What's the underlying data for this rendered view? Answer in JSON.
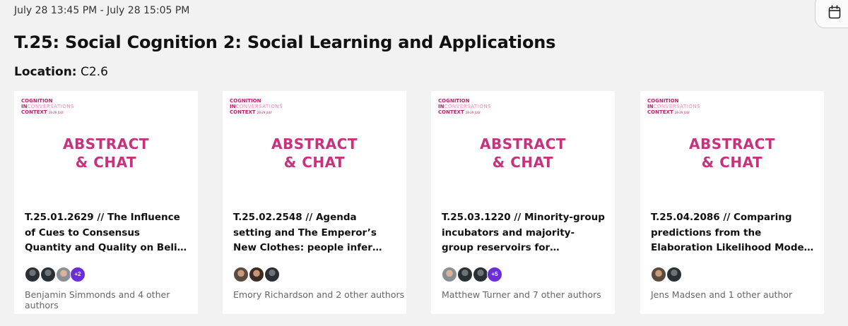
{
  "header": {
    "datetime": "July 28 13:45 PM - July 28 15:05 PM",
    "calendar_icon": "calendar-icon"
  },
  "session": {
    "title": "T.25: Social Cognition 2: Social Learning and Applications",
    "location_label": "Location:",
    "location_value": "C2.6"
  },
  "logo": {
    "line1": "COGNITION",
    "line2a": "IN",
    "line2b": "CONVERSATIONS",
    "line3": "CONTEXT",
    "line3_small": "28-29 JULY"
  },
  "banner": {
    "line1": "ABSTRACT",
    "line2": "& CHAT"
  },
  "cards": [
    {
      "title": "T.25.01.2629 // The Influence of Cues to Consensus Quantity and Quality on Belief in Health Claims",
      "more_count": "+2",
      "authors": "Benjamin Simmonds  and 4 other authors"
    },
    {
      "title": "T.25.02.2548 // Agenda setting and The Emperor’s New Clothes: people infer that letting powerful…",
      "more_count": "",
      "authors": "Emory Richardson  and 2 other authors"
    },
    {
      "title": "T.25.03.1220 // Minority-group incubators and majority-group reservoirs for promoting the…",
      "more_count": "+5",
      "authors": "Matthew Turner  and 7 other authors"
    },
    {
      "title": "T.25.04.2086 // Comparing predictions from the Elaboration Likelihood Model and a Bayesian…",
      "more_count": "",
      "authors": "Jens Madsen  and 1 other author"
    }
  ]
}
